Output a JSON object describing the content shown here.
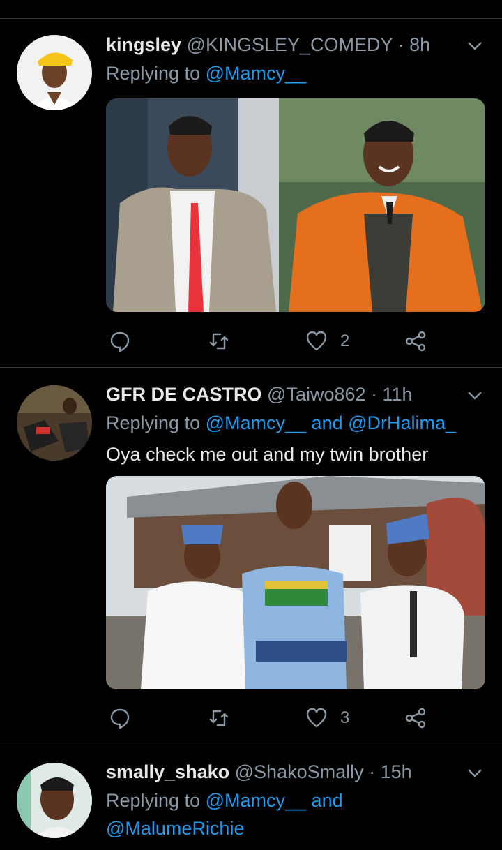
{
  "tweets": [
    {
      "name": "kingsley",
      "handle": "@KINGSLEY_COMEDY",
      "time": "8h",
      "replying_prefix": "Replying to ",
      "mentions": [
        "@Mamcy__"
      ],
      "text": "",
      "likes": "2",
      "icons": [
        "reply-icon",
        "retweet-icon",
        "heart-icon",
        "share-icon"
      ]
    },
    {
      "name": "GFR DE CASTRO",
      "handle": "@Taiwo862",
      "time": "11h",
      "replying_prefix": "Replying to ",
      "mentions": [
        "@Mamcy__",
        "@DrHalima_"
      ],
      "joiner": " and ",
      "text": "Oya check me out and my twin brother",
      "likes": "3"
    },
    {
      "name": "smally_shako",
      "handle": "@ShakoSmally",
      "time": "15h",
      "replying_prefix": "Replying to ",
      "mentions": [
        "@Mamcy__",
        "@MalumeRichie"
      ],
      "joiner": " and",
      "text": ""
    }
  ],
  "separator": " · ",
  "colors": {
    "background": "#000000",
    "accent": "#1d9bf0",
    "muted": "#8b98a5",
    "text": "#e7e9ea"
  }
}
